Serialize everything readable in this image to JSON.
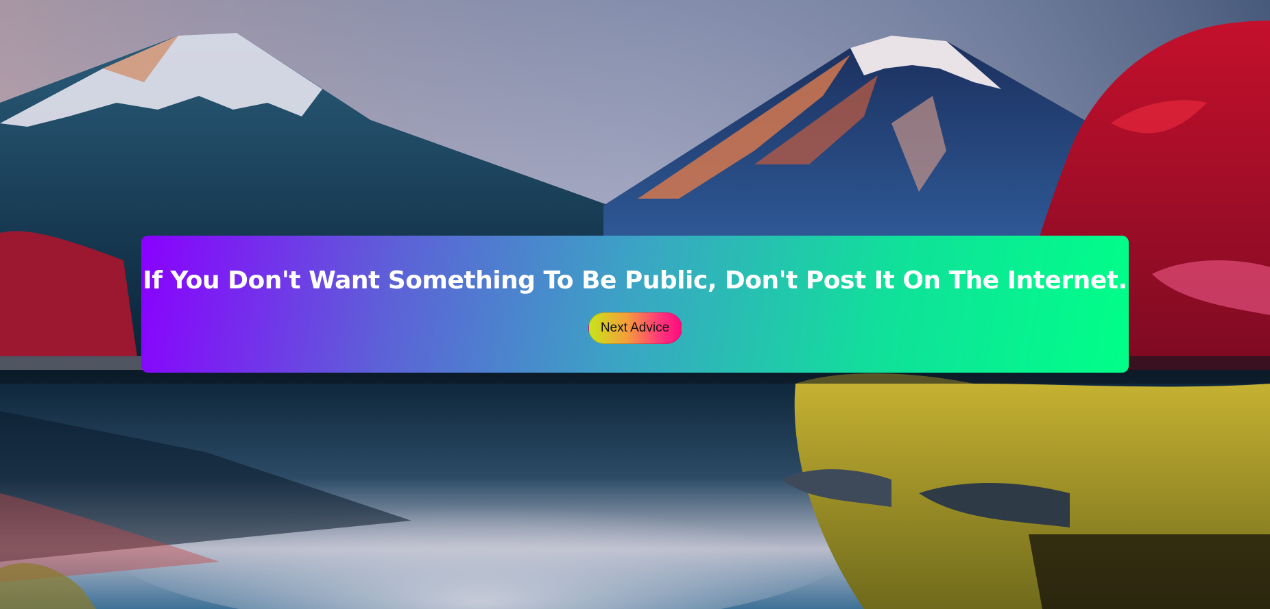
{
  "advice": {
    "text": "If You Don't Want Something To Be Public, Don't Post It On The Internet."
  },
  "button": {
    "label": "Next Advice"
  },
  "colors": {
    "card_gradient_start": "#8a00ff",
    "card_gradient_end": "#00ff88",
    "button_gradient_start": "#c8e41a",
    "button_gradient_end": "#ff0a80",
    "quote_text": "#ffffff"
  },
  "background": {
    "scene": "mountain-lake-landscape"
  }
}
